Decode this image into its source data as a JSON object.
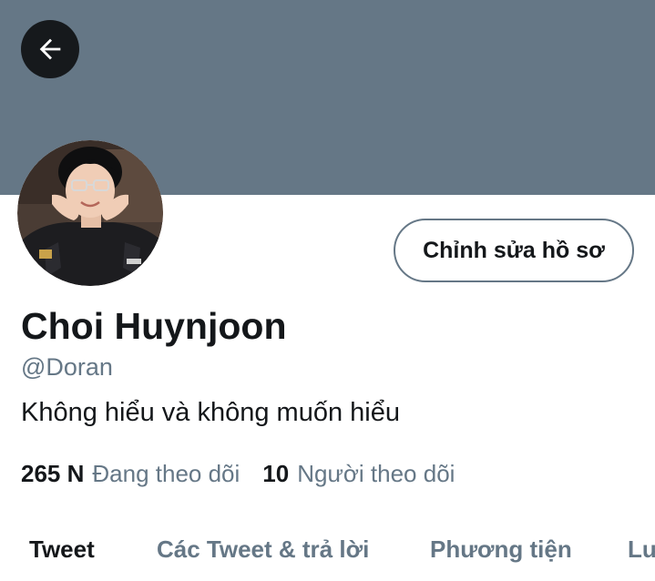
{
  "header": {
    "back_icon": "arrow-left-icon"
  },
  "colors": {
    "banner": "#657786",
    "back_button": "#16191c",
    "primary_text": "#14171a",
    "secondary_text": "#657786",
    "border": "#657786"
  },
  "profile": {
    "display_name": "Choi Huynjoon",
    "handle": "@Doran",
    "bio": "Không hiểu và không muốn hiểu",
    "edit_button_label": "Chỉnh sửa hồ sơ",
    "following_count": "265 N",
    "following_label": "Đang theo dõi",
    "followers_count": "10",
    "followers_label": "Người theo dõi"
  },
  "tabs": [
    {
      "label": "Tweet",
      "active": true
    },
    {
      "label": "Các Tweet & trả lời",
      "active": false
    },
    {
      "label": "Phương tiện",
      "active": false
    },
    {
      "label": "Lượt thích",
      "active": false
    }
  ]
}
